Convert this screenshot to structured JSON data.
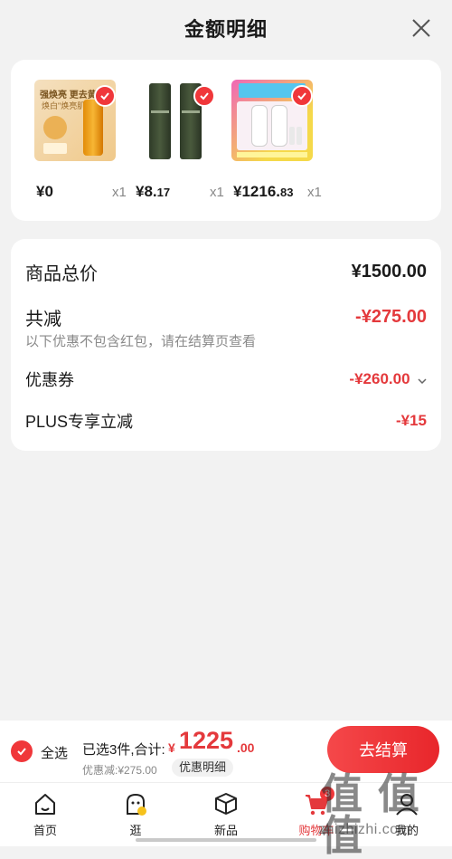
{
  "header": {
    "title": "金额明细"
  },
  "products": [
    {
      "price_main": "¥0",
      "price_cents": "",
      "qty": "x1",
      "thumb_text": "强焕亮 更去黄",
      "thumb_sub": "焕白\"焕亮肌\""
    },
    {
      "price_main": "¥8.",
      "price_cents": "17",
      "qty": "x1"
    },
    {
      "price_main": "¥1216.",
      "price_cents": "83",
      "qty": "x1"
    }
  ],
  "summary": {
    "total_label": "商品总价",
    "total_value": "¥1500.00",
    "reduce_label": "共减",
    "reduce_value": "-¥275.00",
    "reduce_note": "以下优惠不包含红包，请在结算页查看",
    "coupon_label": "优惠券",
    "coupon_value": "-¥260.00",
    "plus_label": "PLUS专享立减",
    "plus_value": "-¥15"
  },
  "bottom": {
    "select_all": "全选",
    "selected_text": "已选3件,合计:",
    "total_symbol": "¥",
    "total_int": "1225",
    "total_dec": ".00",
    "saved_text": "优惠减:¥275.00",
    "detail_button": "优惠明细",
    "checkout_button": "去结算"
  },
  "tabbar": {
    "items": [
      {
        "label": "首页"
      },
      {
        "label": "逛"
      },
      {
        "label": "新品"
      },
      {
        "label": "购物车",
        "badge": "3"
      },
      {
        "label": "我的"
      }
    ]
  },
  "watermark": {
    "text": "值 值 值",
    "url": "zhizhizhi.com"
  },
  "colors": {
    "accent": "#e4393c",
    "background": "#f2f2f2"
  }
}
